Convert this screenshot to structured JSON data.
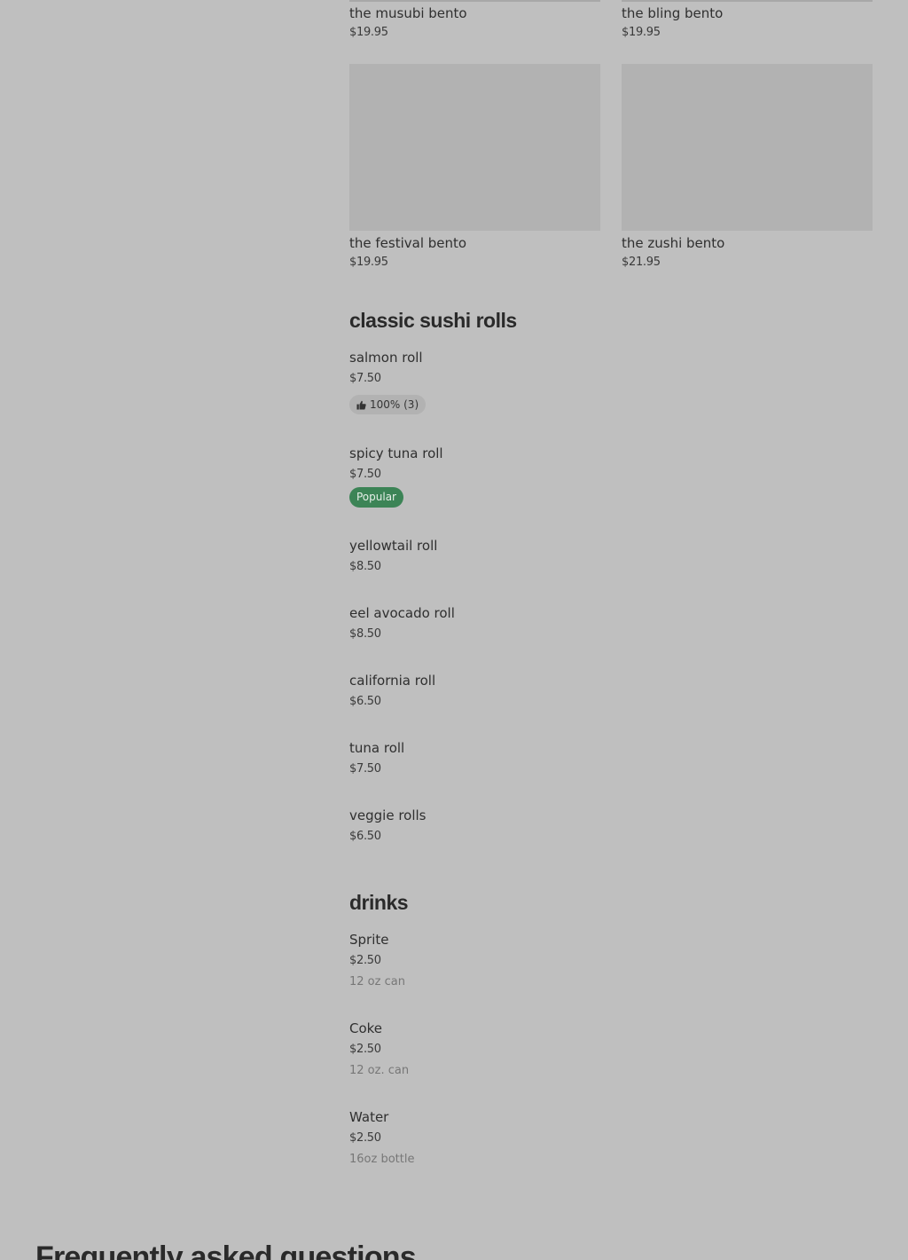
{
  "bento_grid": [
    {
      "title": "the musubi bento",
      "price": "$19.95"
    },
    {
      "title": "the bling bento",
      "price": "$19.95"
    },
    {
      "title": "the festival bento",
      "price": "$19.95"
    },
    {
      "title": "the zushi bento",
      "price": "$21.95"
    }
  ],
  "classic_rolls": {
    "heading": "classic sushi rolls",
    "items": [
      {
        "name": "salmon roll",
        "price": "$7.50",
        "rating": "100% (3)"
      },
      {
        "name": "spicy tuna roll",
        "price": "$7.50",
        "badge": "Popular"
      },
      {
        "name": "yellowtail roll",
        "price": "$8.50"
      },
      {
        "name": "eel avocado roll",
        "price": "$8.50"
      },
      {
        "name": "california roll",
        "price": "$6.50"
      },
      {
        "name": "tuna roll",
        "price": "$7.50"
      },
      {
        "name": "veggie rolls",
        "price": "$6.50"
      }
    ]
  },
  "drinks": {
    "heading": "drinks",
    "items": [
      {
        "name": "Sprite",
        "price": "$2.50",
        "description": "12 oz can"
      },
      {
        "name": "Coke",
        "price": "$2.50",
        "description": "12 oz. can"
      },
      {
        "name": "Water",
        "price": "$2.50",
        "description": "16oz bottle"
      }
    ]
  },
  "faq": {
    "heading": "Frequently asked questions"
  },
  "colors": {
    "background": "#bfbfbf",
    "image_placeholder": "#b2b2b2",
    "popular_badge": "#3c8456",
    "rating_badge": "#b2b2b2"
  },
  "icons": {
    "rating": "thumbs-up-icon"
  }
}
